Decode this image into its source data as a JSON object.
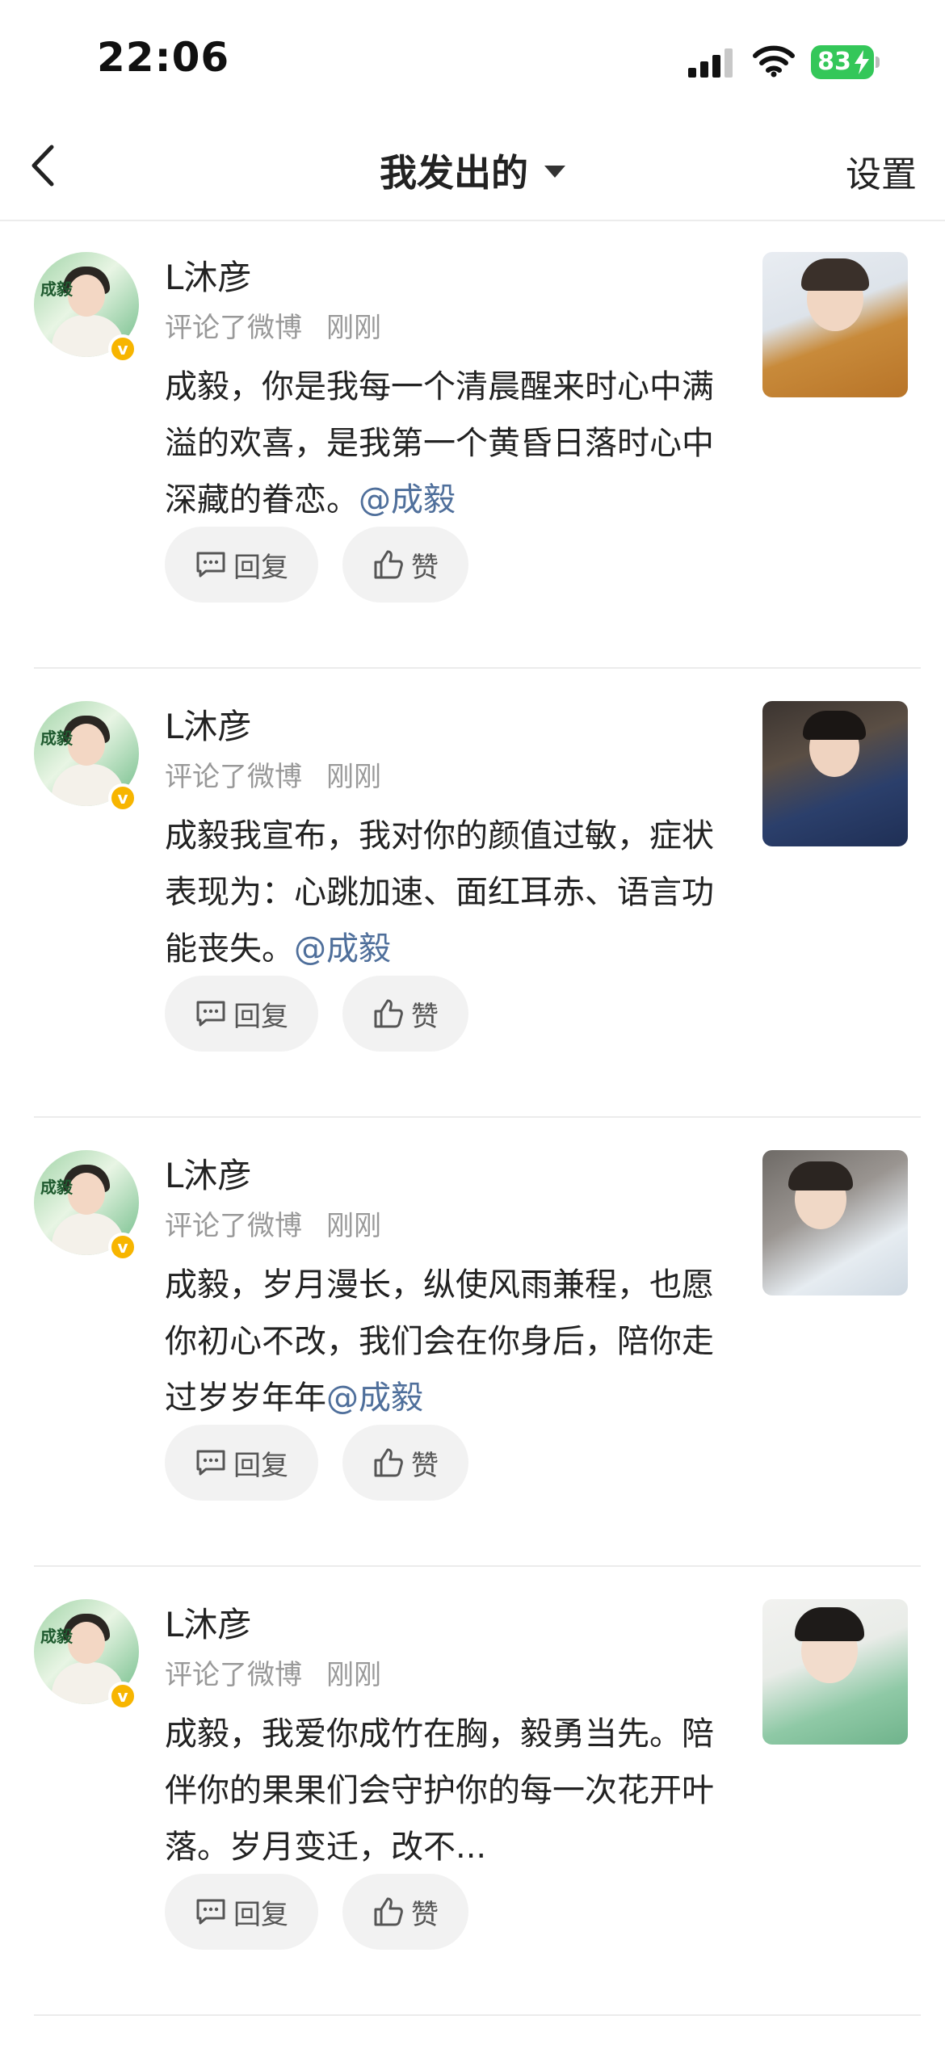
{
  "status_bar": {
    "time": "22:06",
    "battery_percent": "83"
  },
  "nav": {
    "title": "我发出的",
    "settings_label": "设置"
  },
  "avatar_text": "成毅",
  "items": [
    {
      "name": "L沐彦",
      "action": "评论了微博",
      "time": "刚刚",
      "text": "成毅，你是我每一个清晨醒来时心中满溢的欢喜，是我第一个黄昏日落时心中深藏的眷恋。",
      "mention": "@成毅",
      "reply_label": "回复",
      "like_label": "赞"
    },
    {
      "name": "L沐彦",
      "action": "评论了微博",
      "time": "刚刚",
      "text": "成毅我宣布，我对你的颜值过敏，症状表现为：心跳加速、面红耳赤、语言功能丧失。",
      "mention": "@成毅",
      "reply_label": "回复",
      "like_label": "赞"
    },
    {
      "name": "L沐彦",
      "action": "评论了微博",
      "time": "刚刚",
      "text": "成毅，岁月漫长，纵使风雨兼程，也愿你初心不改，我们会在你身后，陪你走过岁岁年年",
      "mention": "@成毅",
      "reply_label": "回复",
      "like_label": "赞"
    },
    {
      "name": "L沐彦",
      "action": "评论了微博",
      "time": "刚刚",
      "text": "成毅，我爱你成竹在胸，毅勇当先。陪伴你的果果们会守护你的每一次花开叶落。岁月变迁，改不...",
      "mention": "",
      "reply_label": "回复",
      "like_label": "赞"
    }
  ],
  "colors": {
    "mention": "#4f6f9b",
    "verified_badge": "#f7b500",
    "battery": "#34c759"
  }
}
